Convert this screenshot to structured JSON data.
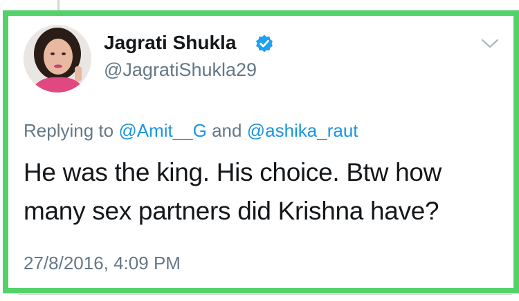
{
  "tweet": {
    "display_name": "Jagrati Shukla",
    "handle": "@JagratiShukla29",
    "verified": true,
    "reply": {
      "prefix": "Replying to",
      "mention_1": "@Amit__G",
      "joiner": "and",
      "mention_2": "@ashika_raut"
    },
    "text": "He was the king. His choice. Btw how many sex partners did Krishna have?",
    "timestamp": "27/8/2016, 4:09 PM"
  },
  "icons": {
    "verified": "verified-badge-icon",
    "menu": "chevron-down-icon"
  },
  "colors": {
    "highlight_frame": "#54d26a",
    "mention_blue": "#1b95e0",
    "verified_blue": "#1da1f2",
    "muted_text": "#657786",
    "body_text": "#14171a"
  }
}
